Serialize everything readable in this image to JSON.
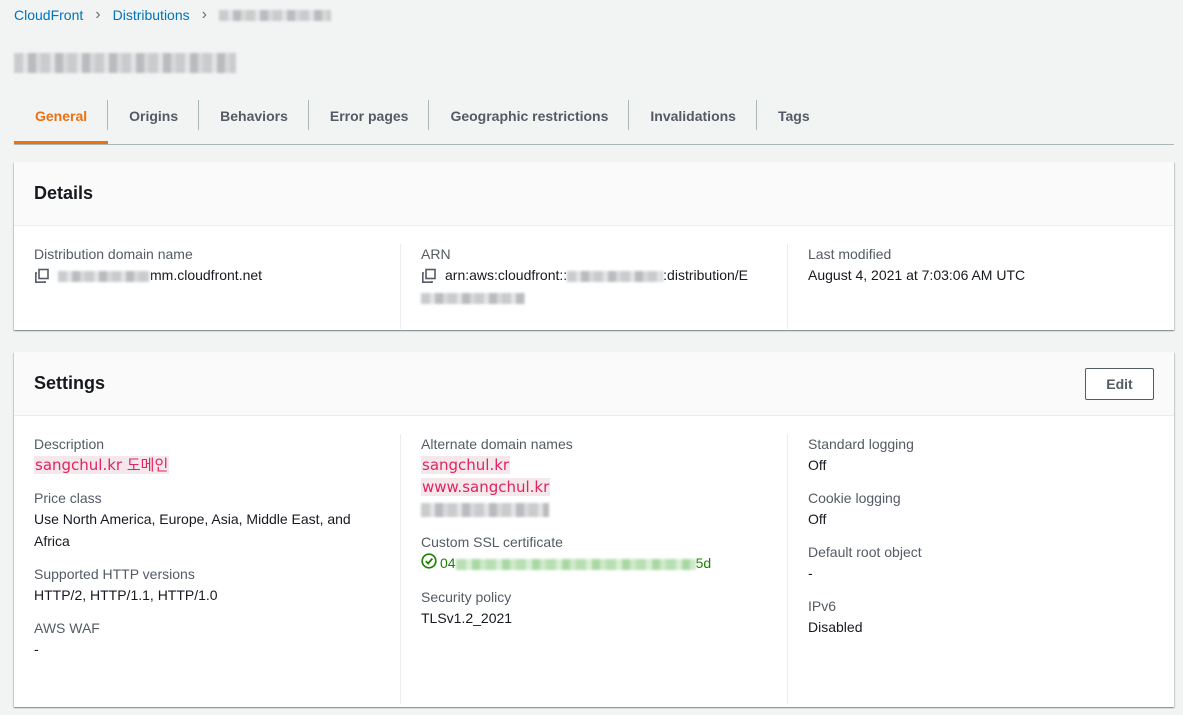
{
  "breadcrumb": {
    "items": [
      "CloudFront",
      "Distributions"
    ]
  },
  "tabs": [
    "General",
    "Origins",
    "Behaviors",
    "Error pages",
    "Geographic restrictions",
    "Invalidations",
    "Tags"
  ],
  "details": {
    "title": "Details",
    "domain_label": "Distribution domain name",
    "domain_value": "mm.cloudfront.net",
    "arn_label": "ARN",
    "arn_prefix": "arn:aws:cloudfront::",
    "arn_suffix": ":distribution/E",
    "modified_label": "Last modified",
    "modified_value": "August 4, 2021 at 7:03:06 AM UTC"
  },
  "settings": {
    "title": "Settings",
    "edit_label": "Edit",
    "description_label": "Description",
    "description_value": "sangchul.kr 도메인",
    "price_class_label": "Price class",
    "price_class_value": "Use North America, Europe, Asia, Middle East, and Africa",
    "http_label": "Supported HTTP versions",
    "http_value": "HTTP/2, HTTP/1.1, HTTP/1.0",
    "waf_label": "AWS WAF",
    "waf_value": "-",
    "alt_domains_label": "Alternate domain names",
    "alt_domains": [
      "sangchul.kr",
      "www.sangchul.kr"
    ],
    "ssl_label": "Custom SSL certificate",
    "ssl_prefix": "04",
    "ssl_suffix": "5d",
    "security_label": "Security policy",
    "security_value": "TLSv1.2_2021",
    "logging_label": "Standard logging",
    "logging_value": "Off",
    "cookie_label": "Cookie logging",
    "cookie_value": "Off",
    "root_label": "Default root object",
    "root_value": "-",
    "ipv6_label": "IPv6",
    "ipv6_value": "Disabled"
  },
  "colors": {
    "accent": "#ec7211",
    "link": "#0073bb",
    "success": "#1d8102",
    "highlight": "#e0245e"
  }
}
